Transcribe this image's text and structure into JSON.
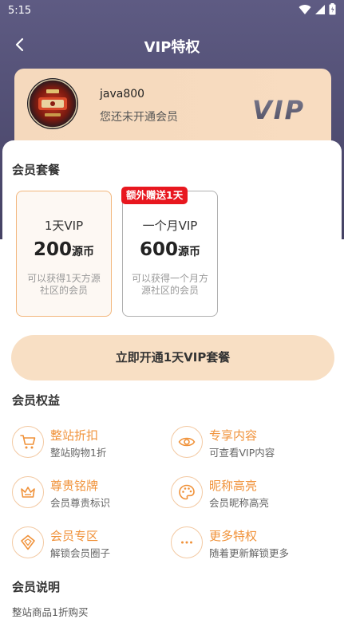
{
  "status_bar": {
    "time": "5:15"
  },
  "nav": {
    "title": "VIP特权"
  },
  "user": {
    "name": "java800",
    "vip_status": "您还未开通会员",
    "vip_logo_text": "VIP"
  },
  "packages": {
    "title": "会员套餐",
    "items": [
      {
        "name": "1天VIP",
        "price": "200",
        "unit": "源币",
        "desc": "可以获得1天方源社区的会员",
        "badge": "",
        "selected": true
      },
      {
        "name": "一个月VIP",
        "price": "600",
        "unit": "源币",
        "desc": "可以获得一个月方源社区的会员",
        "badge": "额外赠送1天",
        "selected": false
      }
    ]
  },
  "buy_button": {
    "label": "立即开通1天VIP套餐"
  },
  "benefits": {
    "title": "会员权益",
    "items": [
      {
        "title": "整站折扣",
        "subtitle": "整站购物1折",
        "icon": "cart-icon"
      },
      {
        "title": "专享内容",
        "subtitle": "可查看VIP内容",
        "icon": "eye-icon"
      },
      {
        "title": "尊贵铭牌",
        "subtitle": "会员尊贵标识",
        "icon": "crown-icon"
      },
      {
        "title": "昵称高亮",
        "subtitle": "会员昵称高亮",
        "icon": "palette-icon"
      },
      {
        "title": "会员专区",
        "subtitle": "解锁会员圈子",
        "icon": "diamond-icon"
      },
      {
        "title": "更多特权",
        "subtitle": "随着更新解锁更多",
        "icon": "more-dots-icon"
      }
    ]
  },
  "explanation": {
    "title": "会员说明",
    "first_line": "整站商品1折购买"
  },
  "colors": {
    "accent_orange": "#f0923a",
    "header_purple": "#5e5b83",
    "card_peach": "#f5d9bd",
    "badge_red": "#e8171f"
  }
}
